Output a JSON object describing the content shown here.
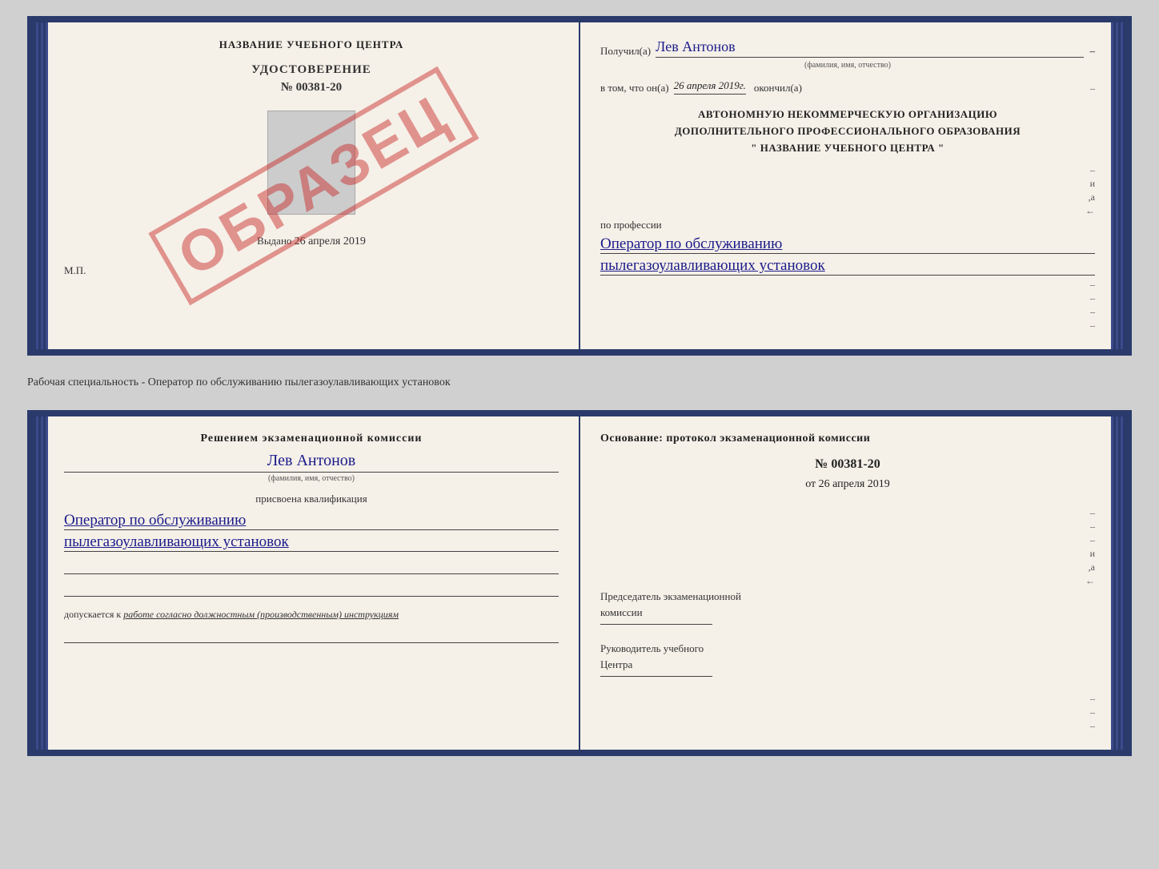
{
  "top_booklet": {
    "left": {
      "training_center_title": "НАЗВАНИЕ УЧЕБНОГО ЦЕНТРА",
      "udostoverenie_label": "УДОСТОВЕРЕНИЕ",
      "cert_number": "№ 00381-20",
      "vydano_prefix": "Выдано",
      "vydano_date": "26 апреля 2019",
      "mp_label": "М.П.",
      "obrazets": "ОБРАЗЕЦ"
    },
    "right": {
      "poluchil_prefix": "Получил(а)",
      "recipient_name": "Лев Антонов",
      "fio_subtitle": "(фамилия, имя, отчество)",
      "vtom_prefix": "в том, что он(а)",
      "vtom_date": "26 апреля 2019г.",
      "okonchill_label": "окончил(а)",
      "org_line1": "АВТОНОМНУЮ НЕКОММЕРЧЕСКУЮ ОРГАНИЗАЦИЮ",
      "org_line2": "ДОПОЛНИТЕЛЬНОГО ПРОФЕССИОНАЛЬНОГО ОБРАЗОВАНИЯ",
      "org_line3": "\"  НАЗВАНИЕ УЧЕБНОГО ЦЕНТРА  \"",
      "po_professii": "по профессии",
      "profession_line1": "Оператор по обслуживанию",
      "profession_line2": "пылегазоулавливающих установок",
      "side_dashes": [
        "-",
        "-",
        "-",
        "-",
        "и",
        ",а",
        "←",
        "-",
        "-",
        "-"
      ]
    }
  },
  "middle_text": "Рабочая специальность - Оператор по обслуживанию пылегазоулавливающих установок",
  "bottom_booklet": {
    "left": {
      "decision_text": "Решением экзаменационной комиссии",
      "name": "Лев Антонов",
      "fio_subtitle": "(фамилия, имя, отчество)",
      "prisvoena": "присвоена квалификация",
      "qualification_line1": "Оператор по обслуживанию",
      "qualification_line2": "пылегазоулавливающих установок",
      "dopuskaetsya_prefix": "допускается к",
      "dopuskaetsya_text": "работе согласно должностным (производственным) инструкциям"
    },
    "right": {
      "osnovanie": "Основание: протокол экзаменационной комиссии",
      "prot_number": "№ 00381-20",
      "prot_date_prefix": "от",
      "prot_date": "26 апреля 2019",
      "chairman_label1": "Председатель экзаменационной",
      "chairman_label2": "комиссии",
      "ruk_label1": "Руководитель учебного",
      "ruk_label2": "Центра",
      "side_dashes": [
        "-",
        "-",
        "-",
        "-",
        "и",
        ",а",
        "←",
        "-",
        "-",
        "-"
      ]
    }
  }
}
